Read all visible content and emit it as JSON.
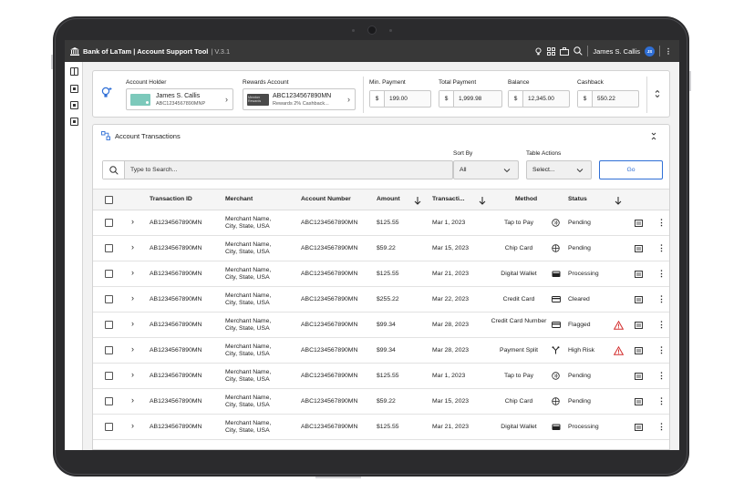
{
  "app": {
    "title": "Bank of LaTam | Account Support Tool",
    "version": "| V.3.1",
    "user_name": "James S. Callis",
    "user_initials": "JS"
  },
  "summary": {
    "account_holder_label": "Account Holder",
    "account_holder_name": "James S. Callis",
    "account_holder_id": "ABC1234567890MNP",
    "rewards_label": "Rewards Account",
    "rewards_card_text": "Member Rewards",
    "rewards_account_id": "ABC1234567890MN",
    "rewards_desc": "Rewards 2% Cashback...",
    "min_payment_label": "Min. Payment",
    "min_payment": "199.00",
    "total_payment_label": "Total Payment",
    "total_payment": "1,999.98",
    "balance_label": "Balance",
    "balance": "12,345.00",
    "cashback_label": "Cashback",
    "cashback": "550.22",
    "currency": "$"
  },
  "transactions_panel": {
    "title": "Account Transactions",
    "search_placeholder": "Type to Search...",
    "sort_by_label": "Sort By",
    "sort_by_value": "All",
    "table_actions_label": "Table Actions",
    "table_actions_value": "Select...",
    "go_label": "Go"
  },
  "table": {
    "columns": [
      "Transaction ID",
      "Merchant",
      "Account Number",
      "Amount",
      "Transacti...",
      "Method",
      "Status"
    ],
    "rows": [
      {
        "id": "AB1234567890MN",
        "merchant_1": "Merchant Name,",
        "merchant_2": "City, State, USA",
        "account": "ABC1234567890MN",
        "amount": "$125.55",
        "date": "Mar 1, 2023",
        "method": "Tap to Pay",
        "method_icon": "tap-icon",
        "status": "Pending",
        "warn": false
      },
      {
        "id": "AB1234567890MN",
        "merchant_1": "Merchant Name,",
        "merchant_2": "City, State, USA",
        "account": "ABC1234567890MN",
        "amount": "$59.22",
        "date": "Mar 15, 2023",
        "method": "Chip Card",
        "method_icon": "chip-icon",
        "status": "Pending",
        "warn": false
      },
      {
        "id": "AB1234567890MN",
        "merchant_1": "Merchant Name,",
        "merchant_2": "City, State, USA",
        "account": "ABC1234567890MN",
        "amount": "$125.55",
        "date": "Mar 21, 2023",
        "method": "Digital Wallet",
        "method_icon": "wallet-icon",
        "status": "Processing",
        "warn": false
      },
      {
        "id": "AB1234567890MN",
        "merchant_1": "Merchant Name,",
        "merchant_2": "City, State, USA",
        "account": "ABC1234567890MN",
        "amount": "$255.22",
        "date": "Mar 22, 2023",
        "method": "Credit Card",
        "method_icon": "card-icon",
        "status": "Cleared",
        "warn": false
      },
      {
        "id": "AB1234567890MN",
        "merchant_1": "Merchant Name,",
        "merchant_2": "City, State, USA",
        "account": "ABC1234567890MN",
        "amount": "$99.34",
        "date": "Mar 28, 2023",
        "method": "Credit Card Number",
        "method_icon": "card-icon",
        "status": "Flagged",
        "warn": true
      },
      {
        "id": "AB1234567890MN",
        "merchant_1": "Merchant Name,",
        "merchant_2": "City, State, USA",
        "account": "ABC1234567890MN",
        "amount": "$99.34",
        "date": "Mar 28, 2023",
        "method": "Payment Split",
        "method_icon": "split-icon",
        "status": "High Risk",
        "warn": true
      },
      {
        "id": "AB1234567890MN",
        "merchant_1": "Merchant Name,",
        "merchant_2": "City, State, USA",
        "account": "ABC1234567890MN",
        "amount": "$125.55",
        "date": "Mar 1, 2023",
        "method": "Tap to Pay",
        "method_icon": "tap-icon",
        "status": "Pending",
        "warn": false
      },
      {
        "id": "AB1234567890MN",
        "merchant_1": "Merchant Name,",
        "merchant_2": "City, State, USA",
        "account": "ABC1234567890MN",
        "amount": "$59.22",
        "date": "Mar 15, 2023",
        "method": "Chip Card",
        "method_icon": "chip-icon",
        "status": "Pending",
        "warn": false
      },
      {
        "id": "AB1234567890MN",
        "merchant_1": "Merchant Name,",
        "merchant_2": "City, State, USA",
        "account": "ABC1234567890MN",
        "amount": "$125.55",
        "date": "Mar 21, 2023",
        "method": "Digital Wallet",
        "method_icon": "wallet-icon",
        "status": "Processing",
        "warn": false
      }
    ]
  },
  "colors": {
    "topbar": "#383838",
    "accent": "#2f6fd6",
    "warning": "#d32f2f",
    "teal_card": "#7cc9bb"
  }
}
